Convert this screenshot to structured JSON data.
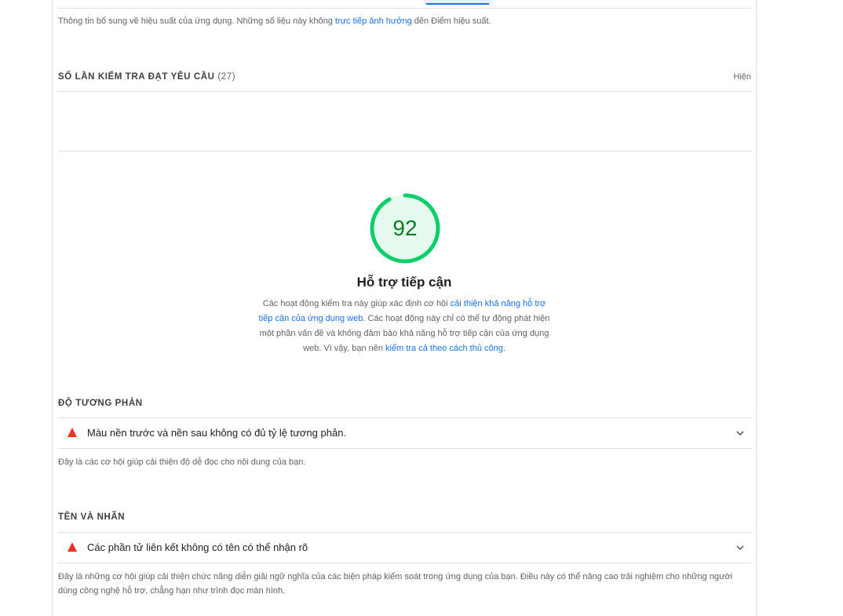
{
  "performance": {
    "note_prefix": "Thông tin bổ sung về hiệu suất của ứng dụng. Những số liệu này không ",
    "note_link": "trực tiếp ảnh hưởng",
    "note_suffix": " đến Điểm hiệu suất."
  },
  "passed_audits": {
    "title": "SỐ LẦN KIỂM TRA ĐẠT YÊU CẦU",
    "count": "(27)",
    "toggle_label": "Hiện"
  },
  "accessibility": {
    "score": "92",
    "score_fraction": 0.92,
    "title": "Hỗ trợ tiếp cận",
    "desc_part1": "Các hoạt động kiểm tra này giúp xác định cơ hội ",
    "desc_link1": "cải thiện khả năng hỗ trợ tiếp cận của ứng dụng web",
    "desc_part2": ". Các hoạt động này chỉ có thể tự động phát hiện một phần vấn đề và không đảm bảo khả năng hỗ trợ tiếp cận của ứng dụng web. Vì vậy, bạn nên ",
    "desc_link2": "kiểm tra cả theo cách thủ công",
    "desc_part3": "."
  },
  "contrast": {
    "title": "ĐỘ TƯƠNG PHẢN",
    "audit_label": "Màu nền trước và nền sau không có đủ tỷ lệ tương phản.",
    "description": "Đây là các cơ hội giúp cải thiện độ dễ đọc cho nội dung của bạn."
  },
  "names_labels": {
    "title": "TÊN VÀ NHÃN",
    "audit_label": "Các phần tử liên kết không có tên có thể nhận rõ",
    "description_line1": "Đây là những cơ hội giúp cải thiện chức năng diễn giải ngữ nghĩa của các biện pháp kiểm soát trong ứng dụng của bạn. Điều này có thể nâng cao trải nghiệm cho những người",
    "description_line2": "dùng công nghệ hỗ trợ, chẳng hạn như trình đọc màn hình."
  },
  "colors": {
    "pass_green": "#0cce6b",
    "pass_fill": "#e6f9ee",
    "score_text": "#0a7e20",
    "fail_red": "#eb3223",
    "link_blue": "#1a73e8"
  }
}
